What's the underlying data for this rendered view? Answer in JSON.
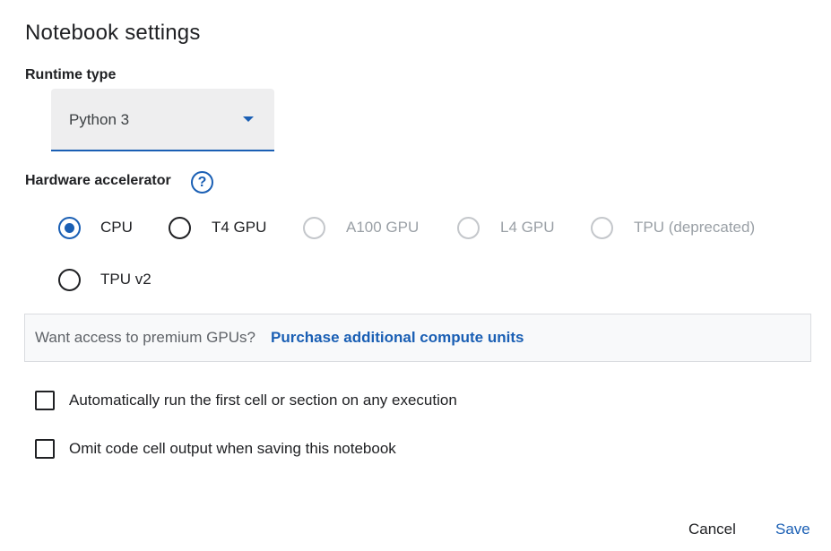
{
  "dialog": {
    "title": "Notebook settings"
  },
  "runtime": {
    "label": "Runtime type",
    "selected": "Python 3"
  },
  "hardware": {
    "label": "Hardware accelerator",
    "help_glyph": "?",
    "options": [
      {
        "label": "CPU",
        "checked": true,
        "disabled": false
      },
      {
        "label": "T4 GPU",
        "checked": false,
        "disabled": false
      },
      {
        "label": "A100 GPU",
        "checked": false,
        "disabled": true
      },
      {
        "label": "L4 GPU",
        "checked": false,
        "disabled": true
      },
      {
        "label": "TPU (deprecated)",
        "checked": false,
        "disabled": true
      },
      {
        "label": "TPU v2",
        "checked": false,
        "disabled": false
      }
    ]
  },
  "premium": {
    "text": "Want access to premium GPUs?",
    "link": "Purchase additional compute units"
  },
  "options": {
    "auto_run": "Automatically run the first cell or section on any execution",
    "omit_output": "Omit code cell output when saving this notebook"
  },
  "actions": {
    "cancel": "Cancel",
    "save": "Save"
  },
  "colors": {
    "accent": "#1a5fb4",
    "select_background": "#eeeeef",
    "disabled_text": "#9aa0a6"
  }
}
